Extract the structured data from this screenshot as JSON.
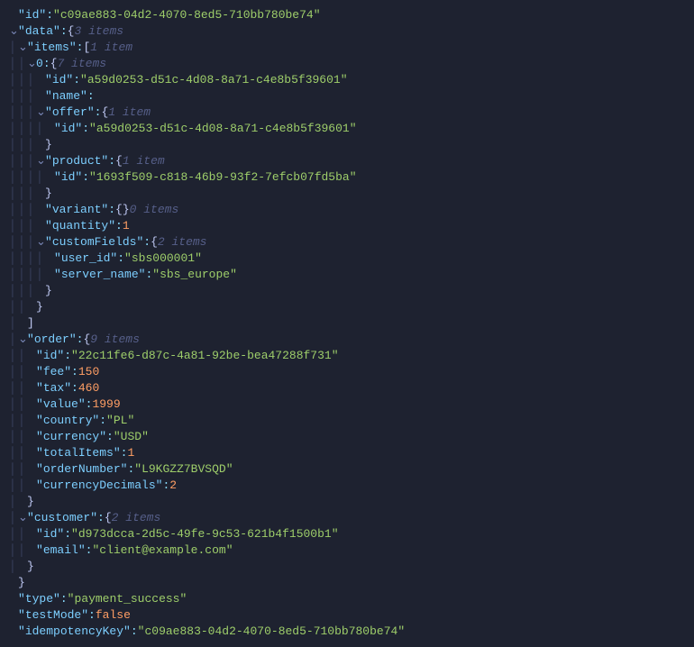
{
  "json_tree": {
    "id": "c09ae883-04d2-4070-8ed5-710bb780be74",
    "data_meta": "3 items",
    "items_meta": "1 item",
    "item0_meta": "7 items",
    "item0": {
      "id": "a59d0253-d51c-4d08-8a71-c4e8b5f39601",
      "name_key": "name",
      "offer_meta": "1 item",
      "offer": {
        "id": "a59d0253-d51c-4d08-8a71-c4e8b5f39601"
      },
      "product_meta": "1 item",
      "product": {
        "id": "1693f509-c818-46b9-93f2-7efcb07fd5ba"
      },
      "variant_meta": "0 items",
      "quantity": 1,
      "customFields_meta": "2 items",
      "customFields": {
        "user_id": "sbs000001",
        "server_name": "sbs_europe"
      }
    },
    "order_meta": "9 items",
    "order": {
      "id": "22c11fe6-d87c-4a81-92be-bea47288f731",
      "fee": 150,
      "tax": 460,
      "value": 1999,
      "country": "PL",
      "currency": "USD",
      "totalItems": 1,
      "orderNumber": "L9KGZZ7BVSQD",
      "currencyDecimals": 2
    },
    "customer_meta": "2 items",
    "customer": {
      "id": "d973dcca-2d5c-49fe-9c53-621b4f1500b1",
      "email": "client@example.com"
    },
    "type": "payment_success",
    "testMode": false,
    "idempotencyKey": "c09ae883-04d2-4070-8ed5-710bb780be74"
  },
  "labels": {
    "id": "id",
    "data": "data",
    "items": "items",
    "zero": "0",
    "name": "name",
    "offer": "offer",
    "product": "product",
    "variant": "variant",
    "quantity": "quantity",
    "customFields": "customFields",
    "user_id": "user_id",
    "server_name": "server_name",
    "order": "order",
    "fee": "fee",
    "tax": "tax",
    "value": "value",
    "country": "country",
    "currency": "currency",
    "totalItems": "totalItems",
    "orderNumber": "orderNumber",
    "currencyDecimals": "currencyDecimals",
    "customer": "customer",
    "email": "email",
    "type": "type",
    "testMode": "testMode",
    "idempotencyKey": "idempotencyKey"
  }
}
